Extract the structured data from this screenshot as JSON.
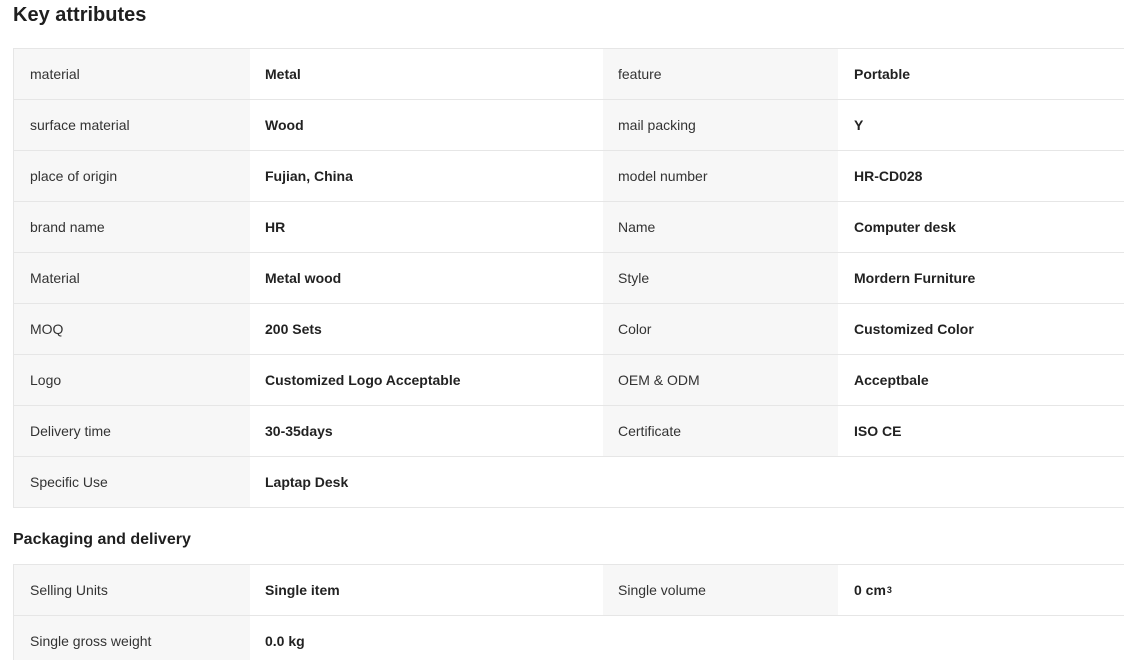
{
  "key_attributes": {
    "title": "Key attributes",
    "rows": [
      {
        "k1": "material",
        "v1": "Metal",
        "k2": "feature",
        "v2": "Portable"
      },
      {
        "k1": "surface material",
        "v1": "Wood",
        "k2": "mail packing",
        "v2": "Y"
      },
      {
        "k1": "place of origin",
        "v1": "Fujian, China",
        "k2": "model number",
        "v2": "HR-CD028"
      },
      {
        "k1": "brand name",
        "v1": "HR",
        "k2": "Name",
        "v2": "Computer desk"
      },
      {
        "k1": "Material",
        "v1": "Metal wood",
        "k2": "Style",
        "v2": "Mordern Furniture"
      },
      {
        "k1": "MOQ",
        "v1": "200 Sets",
        "k2": "Color",
        "v2": "Customized Color"
      },
      {
        "k1": "Logo",
        "v1": "Customized Logo Acceptable",
        "k2": "OEM & ODM",
        "v2": "Acceptbale"
      },
      {
        "k1": "Delivery time",
        "v1": "30-35days",
        "k2": "Certificate",
        "v2": "ISO CE"
      },
      {
        "k1": "Specific Use",
        "v1": "Laptap Desk",
        "k2": "",
        "v2": ""
      }
    ]
  },
  "packaging_delivery": {
    "title": "Packaging and delivery",
    "rows": [
      {
        "k1": "Selling Units",
        "v1": "Single item",
        "k2": "Single volume",
        "v2": "0 cm",
        "v2_sup": "3"
      },
      {
        "k1": "Single gross weight",
        "v1": "0.0 kg",
        "k2": "",
        "v2": ""
      }
    ]
  }
}
